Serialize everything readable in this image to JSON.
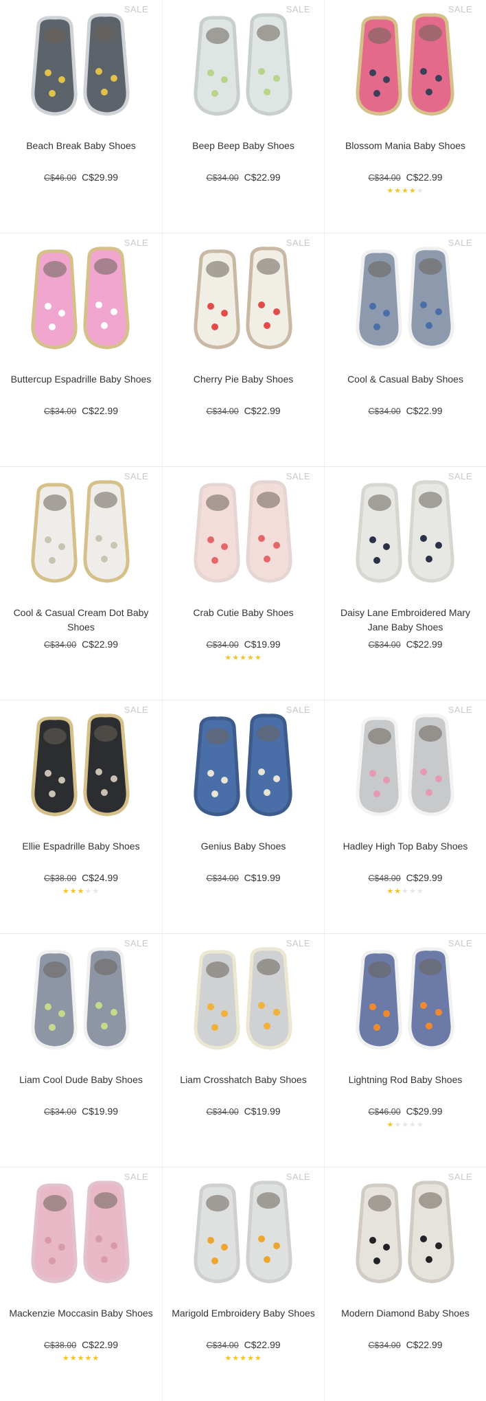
{
  "sale_label": "SALE",
  "rating_max": 5,
  "products": [
    {
      "name": "Beach Break Baby Shoes",
      "old_price": "C$46.00",
      "price": "C$29.99",
      "rating": 0,
      "icon": "shoe-thumbnail",
      "colors": {
        "body": "#5c636b",
        "accent": "#e1c24a",
        "sole": "#cfd2d6"
      }
    },
    {
      "name": "Beep Beep Baby Shoes",
      "old_price": "C$34.00",
      "price": "C$22.99",
      "rating": 0,
      "icon": "shoe-thumbnail",
      "colors": {
        "body": "#dfe5e2",
        "accent": "#b8d48a",
        "sole": "#c9cfcc"
      }
    },
    {
      "name": "Blossom Mania Baby Shoes",
      "old_price": "C$34.00",
      "price": "C$22.99",
      "rating": 4,
      "icon": "shoe-thumbnail",
      "colors": {
        "body": "#e46a8b",
        "accent": "#3b3f57",
        "sole": "#d6c08a"
      }
    },
    {
      "name": "Buttercup Espadrille Baby Shoes",
      "old_price": "C$34.00",
      "price": "C$22.99",
      "rating": 0,
      "icon": "shoe-thumbnail",
      "colors": {
        "body": "#f0a6cf",
        "accent": "#ffffff",
        "sole": "#d6c08a"
      }
    },
    {
      "name": "Cherry Pie Baby Shoes",
      "old_price": "C$34.00",
      "price": "C$22.99",
      "rating": 0,
      "icon": "shoe-thumbnail",
      "colors": {
        "body": "#f1eee6",
        "accent": "#e34b4b",
        "sole": "#c9b9a4"
      }
    },
    {
      "name": "Cool & Casual Baby Shoes",
      "old_price": "C$34.00",
      "price": "C$22.99",
      "rating": 0,
      "icon": "shoe-thumbnail",
      "colors": {
        "body": "#8d99ad",
        "accent": "#4a6fa8",
        "sole": "#f0f0f0"
      }
    },
    {
      "name": "Cool & Casual Cream Dot Baby Shoes",
      "old_price": "C$34.00",
      "price": "C$22.99",
      "rating": 0,
      "icon": "shoe-thumbnail",
      "colors": {
        "body": "#efedea",
        "accent": "#c9c3b4",
        "sole": "#d6c08a"
      }
    },
    {
      "name": "Crab Cutie Baby Shoes",
      "old_price": "C$34.00",
      "price": "C$19.99",
      "rating": 5,
      "icon": "shoe-thumbnail",
      "colors": {
        "body": "#f3ddda",
        "accent": "#e5676a",
        "sole": "#e6d6d3"
      }
    },
    {
      "name": "Daisy Lane Embroidered Mary Jane Baby Shoes",
      "old_price": "C$34.00",
      "price": "C$22.99",
      "rating": 0,
      "icon": "shoe-thumbnail",
      "colors": {
        "body": "#e7e7e4",
        "accent": "#2b3146",
        "sole": "#d8d6d0"
      }
    },
    {
      "name": "Ellie Espadrille Baby Shoes",
      "old_price": "C$38.00",
      "price": "C$24.99",
      "rating": 3,
      "icon": "shoe-thumbnail",
      "colors": {
        "body": "#2b2d30",
        "accent": "#c9c2b4",
        "sole": "#d6c08a"
      }
    },
    {
      "name": "Genius Baby Shoes",
      "old_price": "C$34.00",
      "price": "C$19.99",
      "rating": 0,
      "icon": "shoe-thumbnail",
      "colors": {
        "body": "#4a6fa8",
        "accent": "#e8e4d6",
        "sole": "#3d5c8c"
      }
    },
    {
      "name": "Hadley High Top Baby Shoes",
      "old_price": "C$48.00",
      "price": "C$29.99",
      "rating": 2,
      "icon": "shoe-thumbnail",
      "colors": {
        "body": "#c7c9ca",
        "accent": "#e59ab4",
        "sole": "#f3f3f3"
      }
    },
    {
      "name": "Liam Cool Dude Baby Shoes",
      "old_price": "C$34.00",
      "price": "C$19.99",
      "rating": 0,
      "icon": "shoe-thumbnail",
      "colors": {
        "body": "#8e96a6",
        "accent": "#c6d98c",
        "sole": "#f0f0f0"
      }
    },
    {
      "name": "Liam Crosshatch Baby Shoes",
      "old_price": "C$34.00",
      "price": "C$19.99",
      "rating": 0,
      "icon": "shoe-thumbnail",
      "colors": {
        "body": "#cfd1d2",
        "accent": "#f1b13b",
        "sole": "#ece7d3"
      }
    },
    {
      "name": "Lightning Rod Baby Shoes",
      "old_price": "C$46.00",
      "price": "C$29.99",
      "rating": 1,
      "icon": "shoe-thumbnail",
      "colors": {
        "body": "#6b7aa6",
        "accent": "#f28a2d",
        "sole": "#f0f0f0"
      }
    },
    {
      "name": "Mackenzie Moccasin Baby Shoes",
      "old_price": "C$38.00",
      "price": "C$22.99",
      "rating": 5,
      "icon": "shoe-thumbnail",
      "colors": {
        "body": "#e9b8c7",
        "accent": "#d79aab",
        "sole": "#e2c3cd"
      }
    },
    {
      "name": "Marigold Embroidery Baby Shoes",
      "old_price": "C$34.00",
      "price": "C$22.99",
      "rating": 5,
      "icon": "shoe-thumbnail",
      "colors": {
        "body": "#dfe1e0",
        "accent": "#eda72f",
        "sole": "#cfd1d0"
      }
    },
    {
      "name": "Modern Diamond Baby Shoes",
      "old_price": "C$34.00",
      "price": "C$22.99",
      "rating": 0,
      "icon": "shoe-thumbnail",
      "colors": {
        "body": "#e6e3dd",
        "accent": "#222326",
        "sole": "#d0ccc4"
      }
    }
  ]
}
